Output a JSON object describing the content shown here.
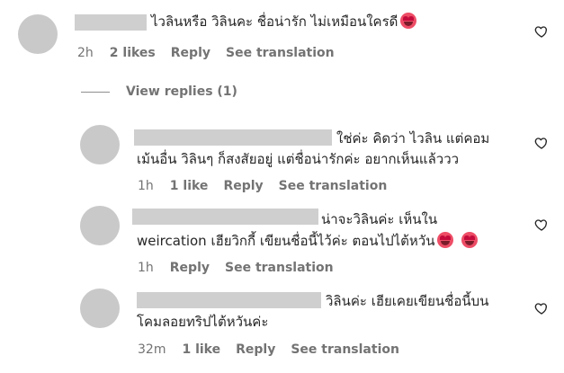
{
  "comments": [
    {
      "text": "ไวลินหรือ วิลินคะ ชื่อน่ารัก ไม่เหมือนใครดี",
      "emoji": "heart-eyes",
      "time": "2h",
      "likes": "2 likes",
      "reply": "Reply",
      "translate": "See translation"
    },
    {
      "line1": "ใช่ค่ะ คิดว่า ไวลิน แต่คอม",
      "line2": "เม้นอื่น วิลินๆ ก็สงสัยอยู่ แต่ชื่อน่ารักค่ะ อยากเห็นแล้ววว",
      "time": "1h",
      "likes": "1 like",
      "reply": "Reply",
      "translate": "See translation"
    },
    {
      "line1": "น่าจะวิลินค่ะ เห็นใน",
      "line2": "weircation เฮียวิกกี้ เขียนชื่อนี้ไว้ค่ะ ตอนไปไต้หวัน",
      "emoji": "heart-eyes",
      "time": "1h",
      "reply": "Reply",
      "translate": "See translation"
    },
    {
      "line1": "วิลินค่ะ เฮียเคยเขียนชื่อนี้บน",
      "line2": "โคมลอยทริปไต้หวันค่ะ",
      "time": "32m",
      "likes": "1 like",
      "reply": "Reply",
      "translate": "See translation"
    }
  ],
  "view_replies": "View replies (1)"
}
